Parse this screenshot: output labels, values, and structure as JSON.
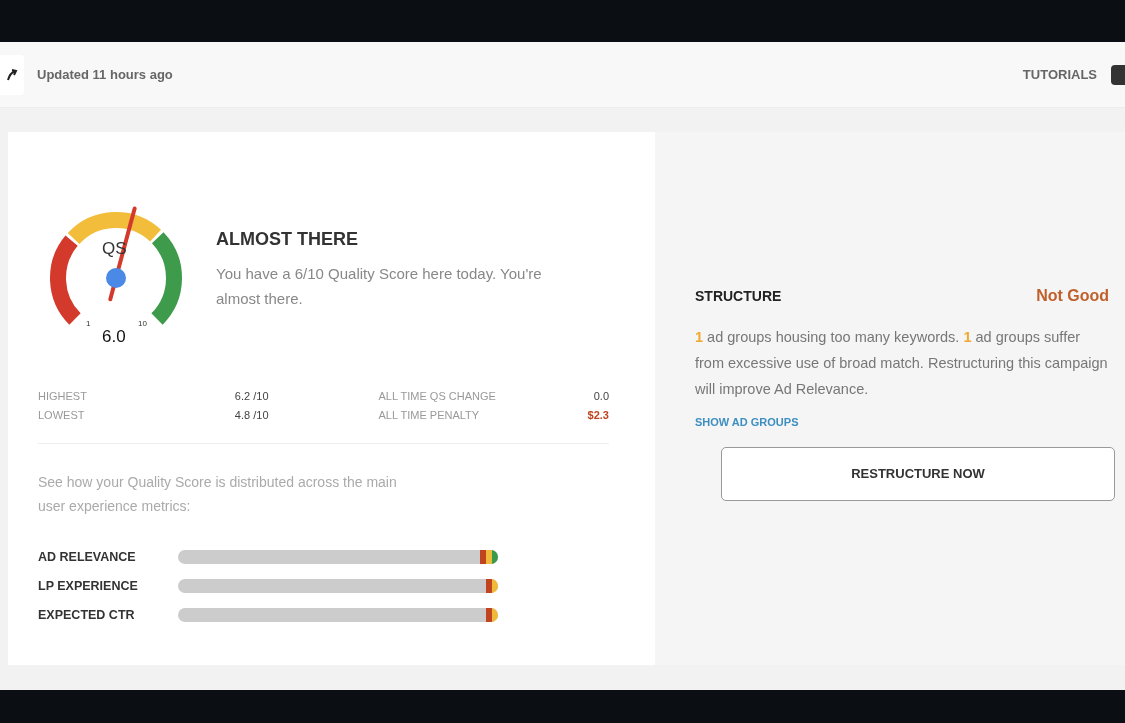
{
  "header": {
    "updated": "Updated 11 hours ago",
    "tutorials": "TUTORIALS"
  },
  "gauge": {
    "label": "QS",
    "min": "1",
    "max": "10",
    "value": "6.0"
  },
  "summary": {
    "title": "ALMOST THERE",
    "text": "You have a 6/10 Quality Score here today. You're almost there."
  },
  "stats": [
    {
      "label": "HIGHEST",
      "value": "6.2 /10",
      "alert": false
    },
    {
      "label": "LOWEST",
      "value": "4.8 /10",
      "alert": false
    },
    {
      "label": "ALL TIME QS CHANGE",
      "value": "0.0",
      "alert": false
    },
    {
      "label": "ALL TIME PENALTY",
      "value": "$2.3",
      "alert": true
    }
  ],
  "metrics_intro": "See how your Quality Score is distributed across the main user experience metrics:",
  "metrics": [
    {
      "label": "AD RELEVANCE",
      "segments": [
        {
          "color": "#c0441f"
        },
        {
          "color": "#f0b93a"
        },
        {
          "color": "#3a9a4a"
        }
      ]
    },
    {
      "label": "LP EXPERIENCE",
      "segments": [
        {
          "color": "#c0441f"
        },
        {
          "color": "#f0b93a"
        }
      ]
    },
    {
      "label": "EXPECTED CTR",
      "segments": [
        {
          "color": "#c0441f"
        },
        {
          "color": "#f0b93a"
        }
      ]
    }
  ],
  "structure": {
    "title": "STRUCTURE",
    "status": "Not Good",
    "parts": [
      {
        "text": "1",
        "highlight": true
      },
      {
        "text": " ad groups housing too many keywords. ",
        "highlight": false
      },
      {
        "text": "1",
        "highlight": true
      },
      {
        "text": " ad groups suffer from excessive use of broad match. Restructuring this campaign will improve Ad Relevance.",
        "highlight": false
      }
    ],
    "link": "SHOW AD GROUPS",
    "button": "RESTRUCTURE NOW"
  }
}
